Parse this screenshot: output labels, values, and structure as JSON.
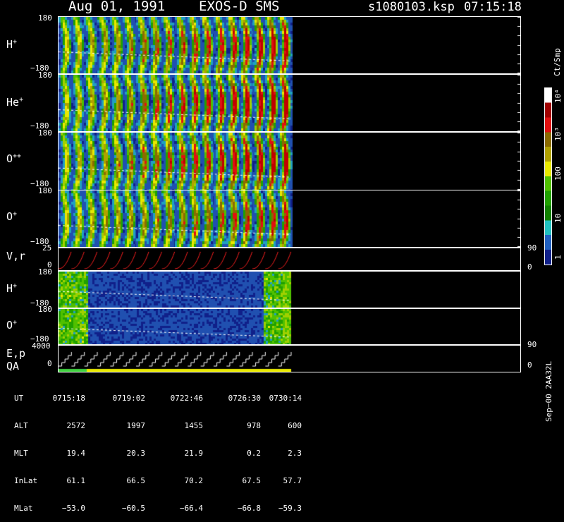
{
  "header": {
    "date": "Aug 01, 1991",
    "mission": "EXOS-D SMS",
    "file": "s1080103.ksp",
    "time": "07:15:18"
  },
  "panels": {
    "p1": {
      "label_main": "H",
      "label_sup": "+",
      "ytop": "180",
      "ybot": "−180"
    },
    "p2": {
      "label_main": "He",
      "label_sup": "+",
      "ytop": "180",
      "ybot": "−180"
    },
    "p3": {
      "label_main": "O",
      "label_sup": "++",
      "ytop": "180",
      "ybot": "−180"
    },
    "p4": {
      "label_main": "O",
      "label_sup": "+",
      "ytop": "180",
      "ybot": "−180"
    },
    "p5": {
      "label_main": "V,r",
      "ytop": "25",
      "ybot": "0",
      "rtop": "90",
      "rbot": "0"
    },
    "p6": {
      "label_main": "H",
      "label_sup": "+",
      "ytop": "180",
      "ybot": "−180"
    },
    "p7": {
      "label_main": "O",
      "label_sup": "+",
      "ytop": "180",
      "ybot": "−180",
      "rtop": "90"
    },
    "p8": {
      "label_main": "E,p",
      "label_2": "QA",
      "ytop": "4000",
      "ybot": "0",
      "rbot": "0"
    }
  },
  "colorbar": {
    "unit": "Ct/Smp",
    "ticks": [
      "10⁴",
      "10³",
      "100",
      "10",
      "1"
    ],
    "colors": [
      "#ffffff",
      "#a00000",
      "#e01010",
      "#8a6a00",
      "#b0a000",
      "#e8e800",
      "#50c000",
      "#20a000",
      "#108000",
      "#20c0c0",
      "#2060c0",
      "#10208a"
    ]
  },
  "footer": {
    "row_labels": [
      "UT",
      "ALT",
      "MLT",
      "InLat",
      "MLat"
    ],
    "columns": [
      [
        "0715:18",
        "2572",
        "19.4",
        "61.1",
        "−53.0"
      ],
      [
        "0719:02",
        "1997",
        "20.3",
        "66.5",
        "−60.5"
      ],
      [
        "0722:46",
        "1455",
        "21.9",
        "70.2",
        "−66.4"
      ],
      [
        "0726:30",
        "978",
        "0.2",
        "67.5",
        "−66.8"
      ],
      [
        "0730:14",
        "600",
        "2.3",
        "57.7",
        "−59.3"
      ]
    ]
  },
  "side_note": "Sep−00  2AA32L"
}
